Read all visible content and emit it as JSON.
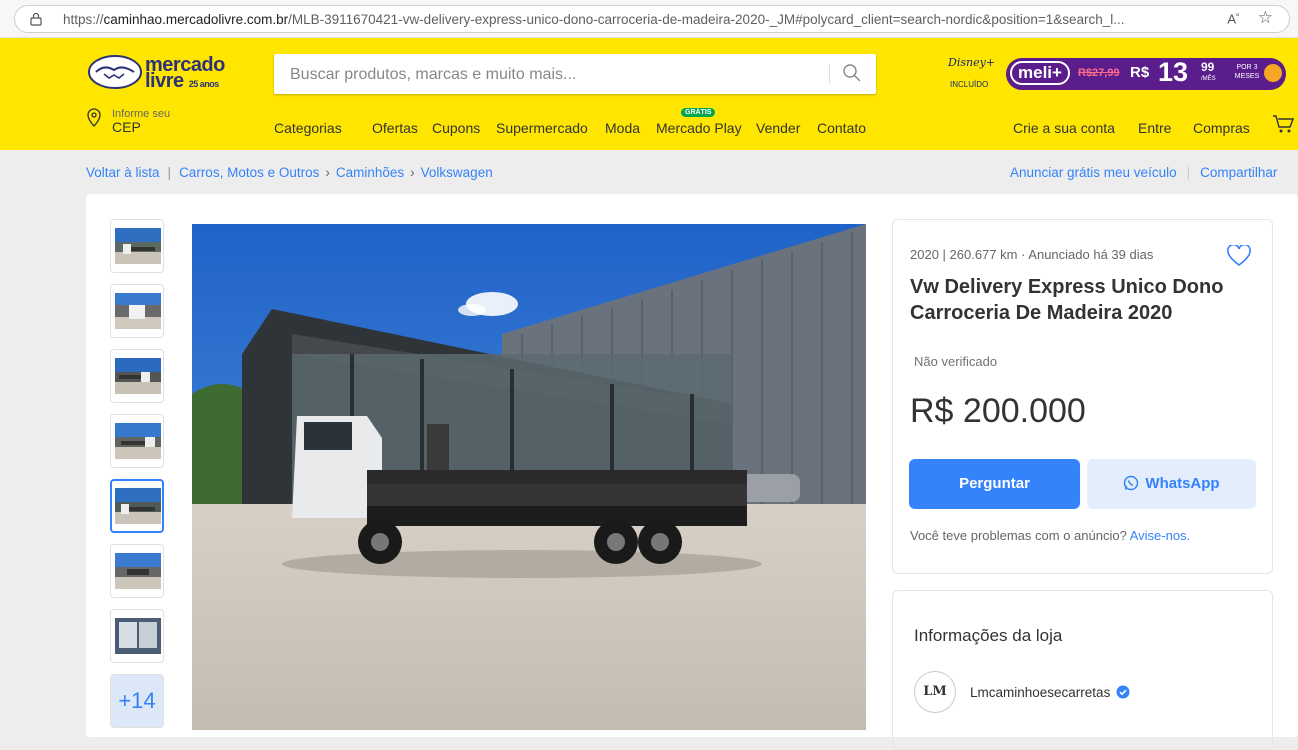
{
  "browser": {
    "url_prefix": "https://",
    "url_domain": "caminhao.mercadolivre.com.br",
    "url_rest": "/MLB-3911670421-vw-delivery-express-unico-dono-carroceria-de-madeira-2020-_JM#polycard_client=search-nordic&position=1&search_l..."
  },
  "header": {
    "logo_line1": "mercado",
    "logo_line2": "livre",
    "logo_years": "25 anos",
    "search_placeholder": "Buscar produtos, marcas e muito mais...",
    "disney_label": "Disney+",
    "disney_sub": "INCLUÍDO",
    "promo_badge": "meli+",
    "promo_old_price": "R$27,99",
    "promo_currency": "R$",
    "promo_price_int": "13",
    "promo_price_cents": "99",
    "promo_per": "/MÊS",
    "promo_period": "POR 3 MESES",
    "cep_line1": "Informe seu",
    "cep_line2": "CEP",
    "nav": {
      "categorias": "Categorias",
      "ofertas": "Ofertas",
      "cupons": "Cupons",
      "supermercado": "Supermercado",
      "moda": "Moda",
      "mercado_play": "Mercado Play",
      "gratis_badge": "GRÁTIS",
      "vender": "Vender",
      "contato": "Contato"
    },
    "account": {
      "create": "Crie a sua conta",
      "login": "Entre",
      "purchases": "Compras"
    }
  },
  "breadcrumb": {
    "back": "Voltar à lista",
    "items": [
      "Carros, Motos e Outros",
      "Caminhões",
      "Volkswagen"
    ],
    "sell": "Anunciar grátis meu veículo",
    "share": "Compartilhar"
  },
  "gallery": {
    "more_count": "+14",
    "active_index": 4
  },
  "listing": {
    "subtitle": "2020 | 260.677 km · Anunciado há 39 dias",
    "title": "Vw Delivery Express Unico Dono Carroceria De Madeira 2020",
    "verification": "Não verificado",
    "price": "R$ 200.000",
    "ask_button": "Perguntar",
    "whatsapp_button": "WhatsApp",
    "problem_text": "Você teve problemas com o anúncio?",
    "problem_link": "Avise-nos."
  },
  "store": {
    "heading": "Informações da loja",
    "avatar_initials": "LM",
    "name": "Lmcaminhoesecarretas"
  },
  "colors": {
    "brand_yellow": "#ffe600",
    "brand_blue": "#3483fa",
    "meli_purple": "#5b1c8c"
  }
}
